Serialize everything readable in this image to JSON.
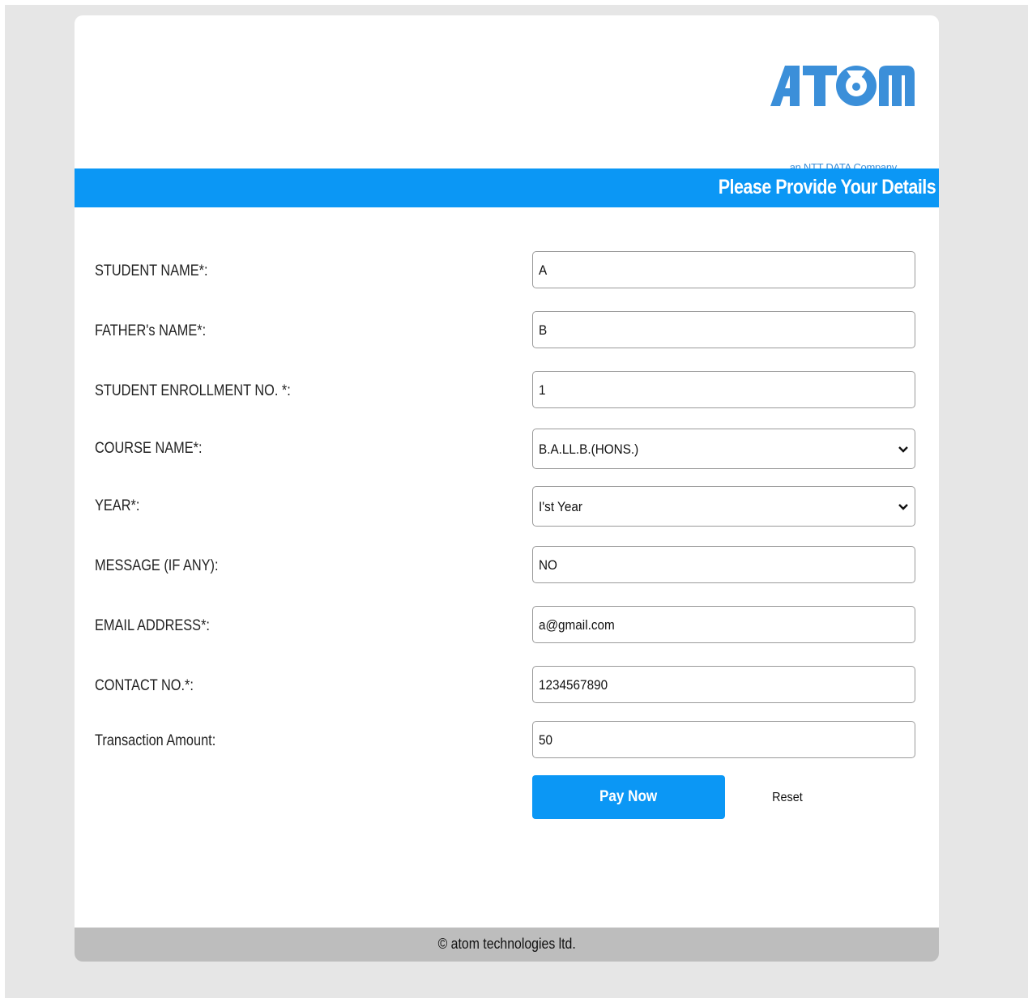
{
  "brand": {
    "logo_text": "ATOM",
    "tagline": "an NTT DATA Company",
    "color": "#3b8fd9"
  },
  "banner": {
    "title": "Please Provide Your Details",
    "color": "#0b97f5"
  },
  "form": {
    "fields": [
      {
        "label": "STUDENT NAME*:",
        "value": "A",
        "type": "text"
      },
      {
        "label": "FATHER's NAME*:",
        "value": "B",
        "type": "text"
      },
      {
        "label": "STUDENT ENROLLMENT NO. *:",
        "value": "1",
        "type": "text"
      },
      {
        "label": "COURSE NAME*:",
        "value": "B.A.LL.B.(HONS.)",
        "type": "select"
      },
      {
        "label": "YEAR*:",
        "value": "I'st Year",
        "type": "select"
      },
      {
        "label": "MESSAGE (IF ANY):",
        "value": "NO",
        "type": "text"
      },
      {
        "label": "EMAIL ADDRESS*:",
        "value": "a@gmail.com",
        "type": "text"
      },
      {
        "label": "CONTACT NO.*:",
        "value": "1234567890",
        "type": "text"
      },
      {
        "label": "Transaction Amount:",
        "value": "50",
        "type": "text"
      }
    ],
    "pay_label": "Pay Now",
    "reset_label": "Reset"
  },
  "footer": {
    "text": "© atom technologies ltd."
  }
}
